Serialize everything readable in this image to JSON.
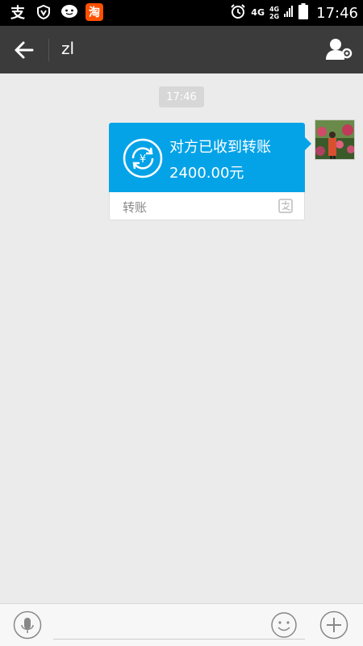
{
  "status_bar": {
    "left_icons": [
      "alipay-icon",
      "shield-icon",
      "chat-bubble-icon",
      "taobao-icon"
    ],
    "alipay_glyph": "支",
    "taobao_glyph": "淘",
    "network_primary": "4G",
    "network_secondary_top": "4G",
    "network_secondary_bottom": "2G",
    "time": "17:46"
  },
  "header": {
    "title": "zl"
  },
  "chat": {
    "timestamp": "17:46",
    "messages": [
      {
        "type": "transfer",
        "title": "对方已收到转账",
        "amount": "2400.00元",
        "card_type": "转账"
      }
    ]
  },
  "input_bar": {
    "placeholder": "",
    "value": ""
  },
  "colors": {
    "status_bar_bg": "#000000",
    "header_bg": "#3b3b3b",
    "chat_bg": "#ebebeb",
    "transfer_card_bg": "#04a3e8",
    "taobao_orange": "#ff5000"
  }
}
